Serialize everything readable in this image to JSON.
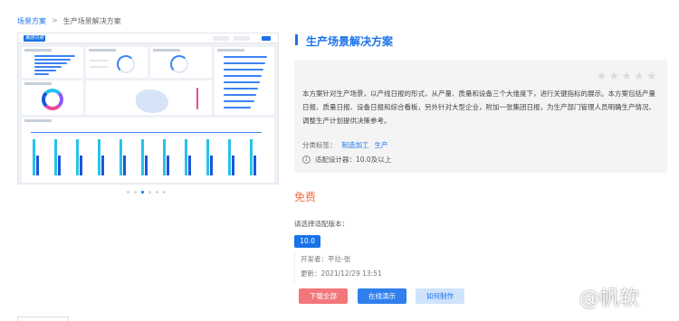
{
  "breadcrumb": {
    "parent": "场景方案",
    "separator": ">",
    "current": "生产场景解决方案"
  },
  "preview": {
    "logo_text": "集团日报",
    "active_dot": 2,
    "dot_count": 6
  },
  "product": {
    "title": "生产场景解决方案",
    "rating_stars": 5,
    "description": "本方案针对生产场景，以产线日报的形式，从产量、质量和设备三个大维度下，进行关键指标的展示。本方案包括产量日报、质量日报、设备日报和综合看板，另外针对大型企业，附加一张集团日报，为生产部门管理人员明确生产情况、调整生产计划提供决策参考。",
    "tags_label": "分类标签：",
    "tags": [
      "制造加工",
      "生产"
    ],
    "compat_text": "适配设计器：10.0及以上"
  },
  "price": "免费",
  "version": {
    "label": "请选择适配版本：",
    "selected": "10.0"
  },
  "meta": {
    "developer": "开发者：平拉-张",
    "updated": "更新：2021/12/29 13:51"
  },
  "buttons": {
    "download": "下载全部",
    "demo": "在线演示",
    "make": "如何制作"
  },
  "watermark": "@帆软",
  "colors": {
    "accent": "#1a73e8",
    "price": "#f0704a",
    "download": "#f3767a"
  }
}
